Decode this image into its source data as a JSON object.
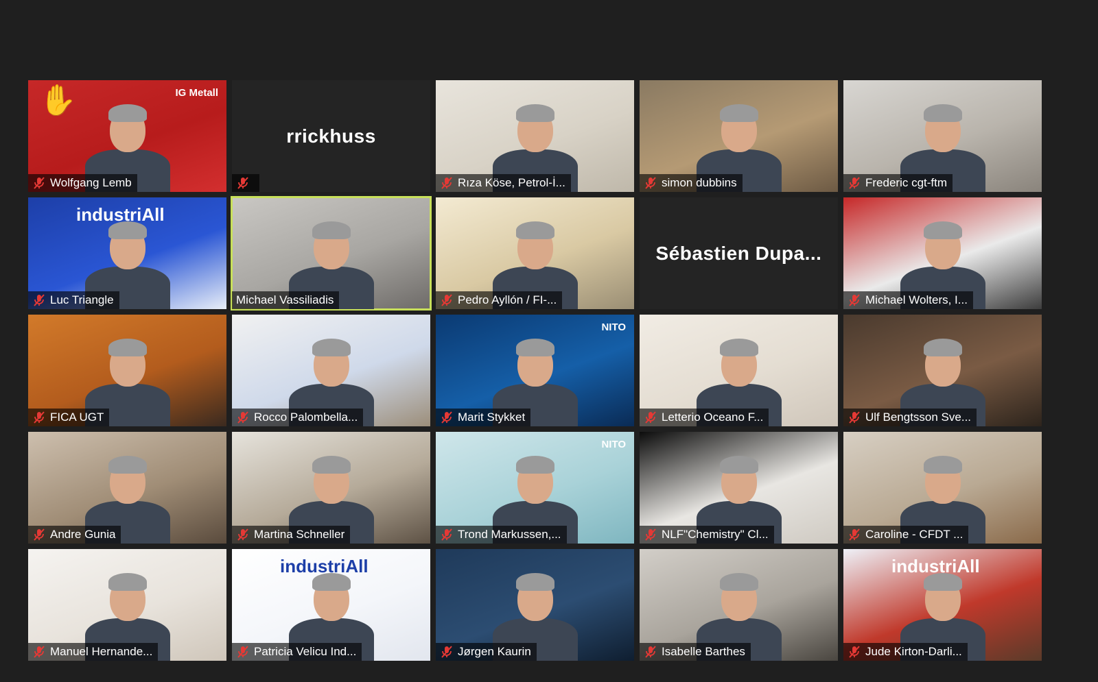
{
  "participants": [
    {
      "name": "Wolfgang Lemb",
      "video": true,
      "muted": true,
      "hand_raised": true,
      "bg": [
        "#c62828",
        "#b71c1c",
        "#d32f2f"
      ],
      "banner": "IG Metall"
    },
    {
      "name": "rrickhuss",
      "video": false,
      "muted": true,
      "display_name": "rrickhuss"
    },
    {
      "name": "Rıza Köse, Petrol-İ...",
      "video": true,
      "muted": true,
      "bg": [
        "#e8e4dc",
        "#d8d2c6",
        "#bfb8aa"
      ]
    },
    {
      "name": "simon dubbins",
      "video": true,
      "muted": true,
      "bg": [
        "#8a7a62",
        "#b59a74",
        "#6d5a44"
      ]
    },
    {
      "name": "Frederic cgt-ftm",
      "video": true,
      "muted": true,
      "bg": [
        "#d8d6d2",
        "#b9b4ac",
        "#8a847c"
      ]
    },
    {
      "name": "Luc Triangle",
      "video": true,
      "muted": true,
      "bg": [
        "#1d3fa8",
        "#2a56d4",
        "#e8eef8"
      ],
      "banner": "industriAll"
    },
    {
      "name": "Michael Vassiliadis",
      "video": true,
      "muted": false,
      "active": true,
      "bg": [
        "#c9c7c3",
        "#a8a6a2",
        "#6e6b68"
      ]
    },
    {
      "name": "Pedro Ayllón / FI-...",
      "video": true,
      "muted": true,
      "bg": [
        "#f3ead2",
        "#d9c9a3",
        "#9a8e74"
      ]
    },
    {
      "name": "Sébastien Dupa...",
      "video": false,
      "muted": false,
      "display_name": "Sébastien Dupa..."
    },
    {
      "name": "Michael Wolters, I...",
      "video": true,
      "muted": true,
      "bg": [
        "#c62828",
        "#eaeaea",
        "#3d3d3d"
      ]
    },
    {
      "name": "FICA UGT",
      "video": true,
      "muted": true,
      "bg": [
        "#d27a2a",
        "#b35c1d",
        "#3b2a1f"
      ]
    },
    {
      "name": "Rocco Palombella...",
      "video": true,
      "muted": true,
      "bg": [
        "#f1f1f1",
        "#cfd9ea",
        "#9c8e7a"
      ]
    },
    {
      "name": "Marit Stykket",
      "video": true,
      "muted": true,
      "bg": [
        "#0b3a72",
        "#155fa8",
        "#0a2b55"
      ],
      "banner": "NITO"
    },
    {
      "name": "Letterio Oceano F...",
      "video": true,
      "muted": true,
      "bg": [
        "#f1ece4",
        "#e4ddd2",
        "#cfc6ba"
      ]
    },
    {
      "name": "Ulf Bengtsson Sve...",
      "video": true,
      "muted": true,
      "bg": [
        "#4a3a2e",
        "#7a5b44",
        "#2d241c"
      ]
    },
    {
      "name": "Andre Gunia",
      "video": true,
      "muted": true,
      "bg": [
        "#cdbfae",
        "#a08d76",
        "#5a4b3d"
      ]
    },
    {
      "name": "Martina Schneller",
      "video": true,
      "muted": true,
      "bg": [
        "#e6e3dc",
        "#b5aa99",
        "#5e5245"
      ]
    },
    {
      "name": "Trond Markussen,...",
      "video": true,
      "muted": true,
      "bg": [
        "#cfe6ea",
        "#a9d2d8",
        "#7fb6c0"
      ],
      "banner": "NITO"
    },
    {
      "name": "NLF\"Chemistry\" Cl...",
      "video": true,
      "muted": true,
      "bg": [
        "#0c0c0c",
        "#e8e6e2",
        "#cfcac2"
      ]
    },
    {
      "name": "Caroline - CFDT ...",
      "video": true,
      "muted": true,
      "bg": [
        "#d7cfc3",
        "#b9a993",
        "#8a6a4a"
      ]
    },
    {
      "name": "Manuel Hernande...",
      "video": true,
      "muted": true,
      "bg": [
        "#f5f3f0",
        "#e8e3dc",
        "#cfc6ba"
      ]
    },
    {
      "name": "Patricia Velicu Ind...",
      "video": true,
      "muted": true,
      "bg": [
        "#ffffff",
        "#f4f6fa",
        "#e2e6ee"
      ],
      "banner": "industriAll"
    },
    {
      "name": "Jørgen Kaurin",
      "video": true,
      "muted": true,
      "bg": [
        "#1f3a5a",
        "#2c4d72",
        "#0f1e30"
      ]
    },
    {
      "name": "Isabelle Barthes",
      "video": true,
      "muted": true,
      "bg": [
        "#d2cec8",
        "#a9a49c",
        "#4a4640"
      ]
    },
    {
      "name": "Jude Kirton-Darli...",
      "video": true,
      "muted": true,
      "bg": [
        "#eef1f8",
        "#c0392b",
        "#5a3b2a"
      ],
      "banner": "industriAll"
    }
  ]
}
